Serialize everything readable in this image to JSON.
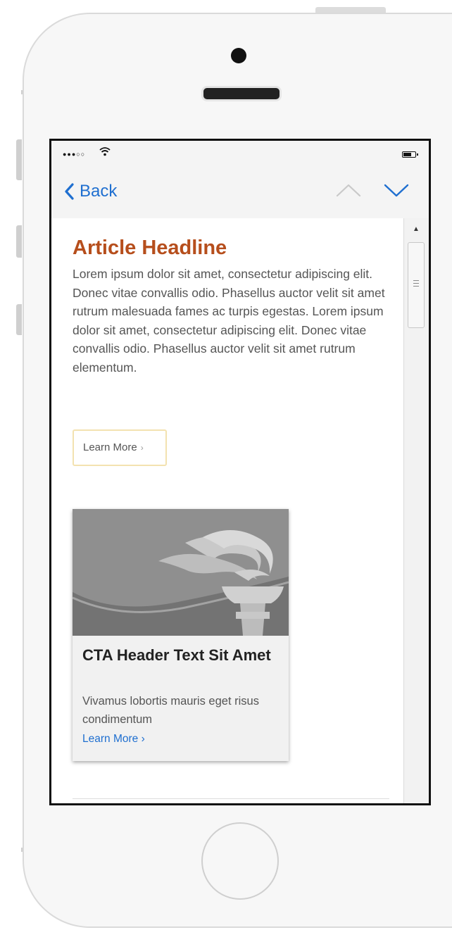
{
  "nav": {
    "back_label": "Back"
  },
  "article": {
    "headline": "Article Headline",
    "body": "Lorem ipsum dolor sit amet, consectetur adipiscing elit. Donec vitae convallis odio. Phasellus auctor velit sit amet rutrum malesuada fames ac turpis egestas. Lorem ipsum dolor sit amet, consectetur adipiscing elit. Donec vitae convallis odio. Phasellus auctor velit sit amet rutrum elementum.",
    "learn_more_label": "Learn More",
    "learn_more_chevron": "›"
  },
  "cta": {
    "title": "CTA Header Text Sit Amet",
    "description": "Vivamus lobortis mauris eget risus condimentum",
    "link_label": "Learn More ›"
  },
  "icons": {
    "back": "chevron-left-icon",
    "up": "chevron-up-icon",
    "down": "chevron-down-icon",
    "image": "torch-icon",
    "wifi": "wifi-icon",
    "battery": "battery-icon"
  },
  "colors": {
    "accent_blue": "#1f6fd0",
    "headline": "#b64e1c",
    "button_border": "#f3e2b0"
  }
}
